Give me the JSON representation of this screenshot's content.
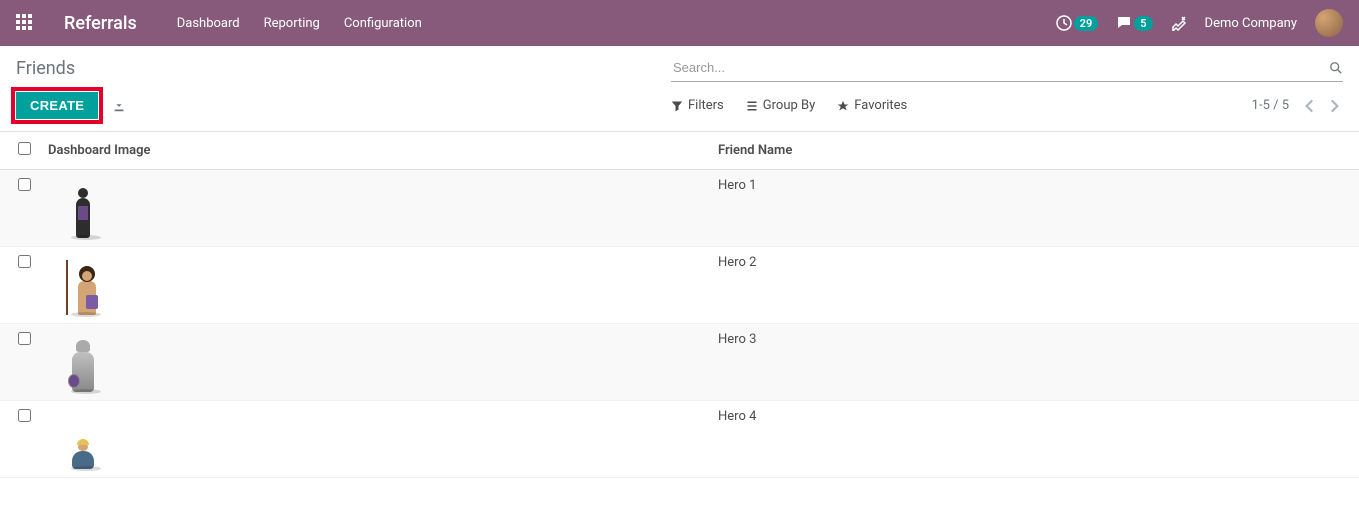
{
  "navbar": {
    "brand": "Referrals",
    "menu": [
      "Dashboard",
      "Reporting",
      "Configuration"
    ],
    "activityBadge": "29",
    "messagesBadge": "5",
    "company": "Demo Company"
  },
  "controlPanel": {
    "breadcrumb": "Friends",
    "createLabel": "CREATE",
    "searchPlaceholder": "Search...",
    "filtersLabel": "Filters",
    "groupByLabel": "Group By",
    "favoritesLabel": "Favorites",
    "pager": "1-5 / 5"
  },
  "table": {
    "headers": {
      "image": "Dashboard Image",
      "name": "Friend Name"
    },
    "rows": [
      {
        "name": "Hero 1",
        "heroClass": "hero1"
      },
      {
        "name": "Hero 2",
        "heroClass": "hero2"
      },
      {
        "name": "Hero 3",
        "heroClass": "hero3"
      },
      {
        "name": "Hero 4",
        "heroClass": "hero4"
      }
    ]
  }
}
